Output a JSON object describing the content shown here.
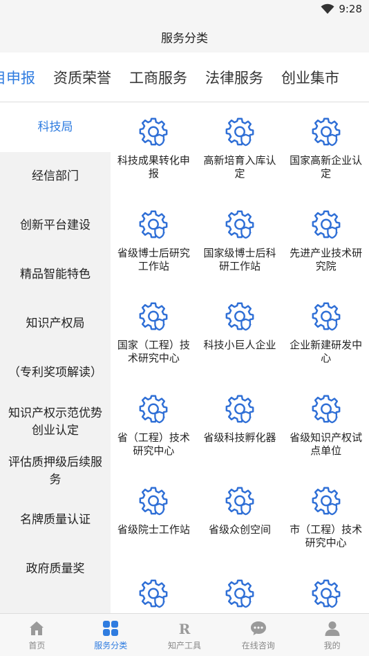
{
  "status": {
    "time": "9:28"
  },
  "header": {
    "title": "服务分类"
  },
  "tabs": [
    {
      "label": "目申报"
    },
    {
      "label": "资质荣誉"
    },
    {
      "label": "工商服务"
    },
    {
      "label": "法律服务"
    },
    {
      "label": "创业集市"
    }
  ],
  "sidebar": {
    "items": [
      {
        "label": "科技局"
      },
      {
        "label": "经信部门"
      },
      {
        "label": "创新平台建设"
      },
      {
        "label": "精品智能特色"
      },
      {
        "label": "知识产权局"
      },
      {
        "label": "（专利奖项解读）"
      },
      {
        "label": "知识产权示范优势创业认定"
      },
      {
        "label": "评估质押级后续服务"
      },
      {
        "label": "名牌质量认证"
      },
      {
        "label": "政府质量奖"
      },
      {
        "label": ""
      }
    ]
  },
  "services": [
    {
      "label": "科技成果转化申报"
    },
    {
      "label": "高新培育入库认定"
    },
    {
      "label": "国家高新企业认定"
    },
    {
      "label": "省级博士后研究工作站"
    },
    {
      "label": "国家级博士后科研工作站"
    },
    {
      "label": "先进产业技术研究院"
    },
    {
      "label": "国家（工程）技术研究中心"
    },
    {
      "label": "科技小巨人企业"
    },
    {
      "label": "企业新建研发中心"
    },
    {
      "label": "省（工程）技术研究中心"
    },
    {
      "label": "省级科技孵化器"
    },
    {
      "label": "省级知识产权试点单位"
    },
    {
      "label": "省级院士工作站"
    },
    {
      "label": "省级众创空间"
    },
    {
      "label": "市（工程）技术研究中心"
    },
    {
      "label": ""
    },
    {
      "label": ""
    },
    {
      "label": ""
    }
  ],
  "bottom_nav": [
    {
      "label": "首页",
      "icon": "home-icon"
    },
    {
      "label": "服务分类",
      "icon": "grid-icon"
    },
    {
      "label": "知产工具",
      "icon": "r-icon"
    },
    {
      "label": "在线咨询",
      "icon": "chat-icon"
    },
    {
      "label": "我的",
      "icon": "user-icon"
    }
  ],
  "colors": {
    "accent": "#2f7ce0",
    "icon_blue": "#2f6fd6",
    "sidebar_bg": "#f2f2f2"
  }
}
